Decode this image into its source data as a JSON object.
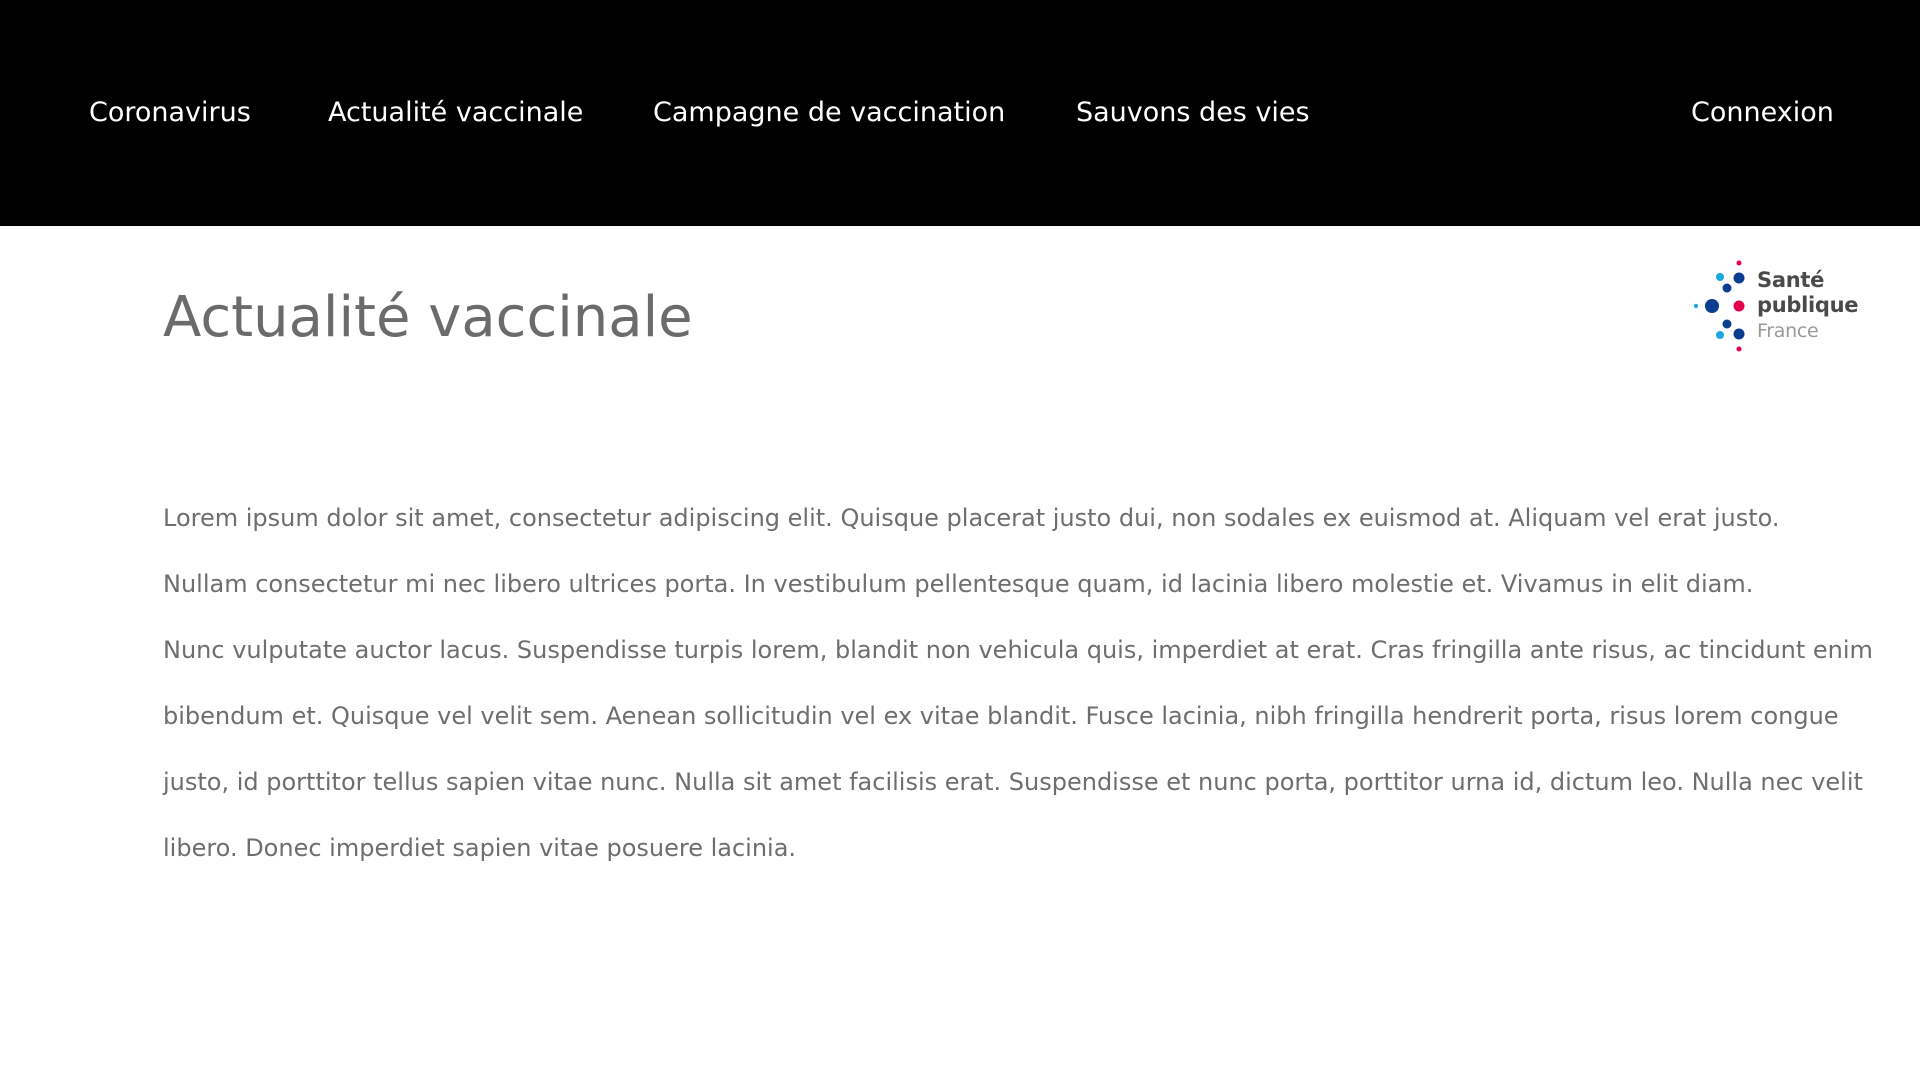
{
  "nav": {
    "items": [
      {
        "label": "Coronavirus"
      },
      {
        "label": "Actualité vaccinale"
      },
      {
        "label": "Campagne de vaccination"
      },
      {
        "label": "Sauvons des vies"
      }
    ],
    "login_label": "Connexion"
  },
  "page": {
    "title": "Actualité vaccinale"
  },
  "logo": {
    "line1": "Santé",
    "line2": "publique",
    "line3": "France",
    "colors": {
      "dark_blue": "#0b3d91",
      "light_blue": "#1ba7e0",
      "pink": "#e5004f",
      "text": "#4a4a4a"
    },
    "icon": "sante-publique-france-logo"
  },
  "content": {
    "paragraphs": [
      "Lorem ipsum dolor sit amet, consectetur adipiscing elit. Quisque placerat justo dui, non sodales ex euismod at. Aliquam vel erat justo.",
      "Nullam consectetur mi nec libero ultrices porta. In vestibulum pellentesque quam, id lacinia libero molestie et. Vivamus in elit diam.",
      "Nunc vulputate auctor lacus. Suspendisse turpis lorem, blandit non vehicula quis, imperdiet at erat. Cras fringilla ante risus, ac tincidunt enim bibendum et. Quisque vel velit sem. Aenean sollicitudin vel ex vitae blandit. Fusce lacinia, nibh fringilla hendrerit porta, risus lorem congue justo, id porttitor tellus sapien vitae nunc. Nulla sit amet facilisis erat. Suspendisse et nunc porta, porttitor urna id, dictum leo. Nulla nec velit libero. Donec imperdiet sapien vitae posuere lacinia."
    ]
  },
  "theme": {
    "header_bg": "#000000",
    "header_text": "#ffffff",
    "body_text": "#6e6e6e"
  }
}
